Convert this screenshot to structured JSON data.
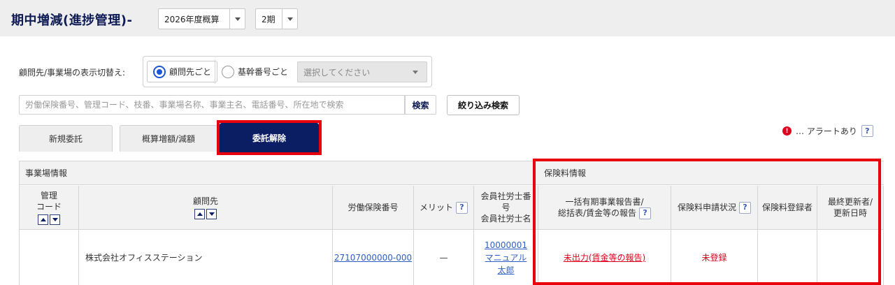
{
  "header": {
    "title": "期中増減(進捗管理)-",
    "year_select": "2026年度概算",
    "period_select": "2期"
  },
  "filter": {
    "switch_label": "顧問先/事業場の表示切替え:",
    "options": [
      "顧問先ごと",
      "基幹番号ごと"
    ],
    "selected_option": "顧問先ごと",
    "select_placeholder": "選択してください",
    "search_placeholder": "労働保険番号、管理コード、枝番、事業場名称、事業主名、電話番号、所在地で検索",
    "search_button": "検索",
    "refine_button": "絞り込み検索"
  },
  "tabs": [
    {
      "label": "新規委託",
      "active": false
    },
    {
      "label": "概算増額/減額",
      "active": false
    },
    {
      "label": "委託解除",
      "active": true
    }
  ],
  "alert_legend": {
    "icon": "alert-icon",
    "icon_glyph": "!",
    "text": "… アラートあり",
    "help": "?"
  },
  "table": {
    "section_office": "事業場情報",
    "section_premium": "保険料情報",
    "columns": {
      "code": [
        "管理",
        "コード"
      ],
      "client": "顧問先",
      "insurance_no": "労働保険番号",
      "merit": "メリット",
      "sharoushi": [
        "会員社労士番",
        "号",
        "会員社労士名"
      ],
      "report": [
        "一括有期事業報告書/",
        "総括表/賃金等の報告"
      ],
      "status": "保険料申請状況",
      "registrant": "保険料登録者",
      "updated": [
        "最終更新者/",
        "更新日時"
      ]
    },
    "rows": [
      {
        "code": "",
        "client": "株式会社オフィスステーション",
        "insurance_no": "27107000000-000",
        "merit": "—",
        "sharoushi_no": "10000001",
        "sharoushi_name": [
          "マニュアル",
          "太郎"
        ],
        "report": "未出力(賃金等の報告)",
        "status": "未登録",
        "registrant": "",
        "updated": ""
      }
    ]
  },
  "colors": {
    "navy": "#0b1d63",
    "highlight_red": "#e8000d",
    "link_blue": "#2f5fc4",
    "alert_red": "#e0001b"
  }
}
